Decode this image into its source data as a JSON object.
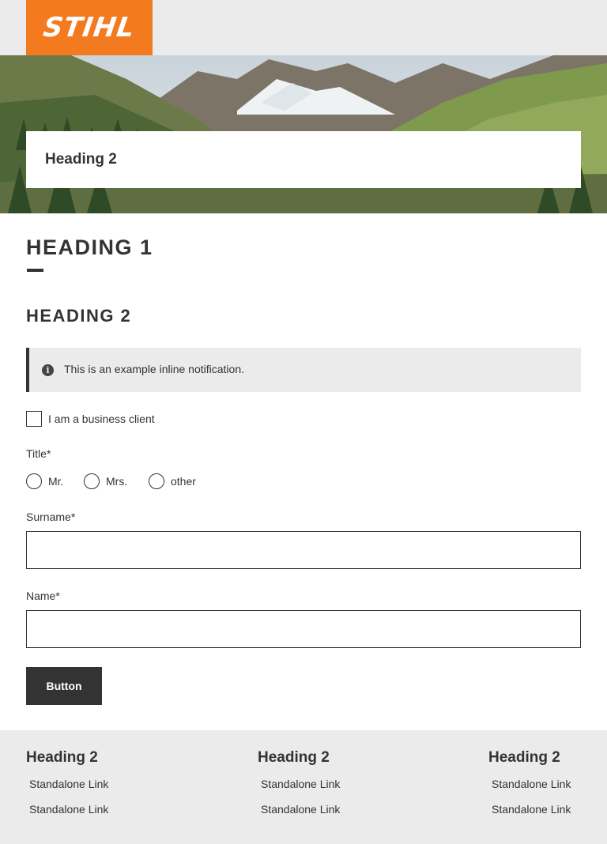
{
  "header": {
    "logo_text": "STIHL",
    "brand_color": "#f37a1f"
  },
  "hero": {
    "image": "alpine-valley-landscape",
    "card_heading": "Heading 2"
  },
  "main": {
    "heading1": "HEADING 1",
    "heading2": "HEADING 2",
    "notification": {
      "icon": "info-icon",
      "text": "This is an example inline notification."
    },
    "checkbox": {
      "label": "I am a business client",
      "checked": false
    },
    "title_field": {
      "label": "Title",
      "required_mark": "*",
      "options": [
        "Mr.",
        "Mrs.",
        "other"
      ],
      "selected": null
    },
    "surname_field": {
      "label": "Surname",
      "required_mark": "*",
      "value": ""
    },
    "name_field": {
      "label": "Name",
      "required_mark": "*",
      "value": ""
    },
    "button_label": "Button"
  },
  "footer": {
    "columns": [
      {
        "heading": "Heading 2",
        "links": [
          "Standalone Link",
          "Standalone Link"
        ]
      },
      {
        "heading": "Heading 2",
        "links": [
          "Standalone Link",
          "Standalone Link"
        ]
      },
      {
        "heading": "Heading 2",
        "links": [
          "Standalone Link",
          "Standalone Link"
        ]
      }
    ]
  },
  "colors": {
    "text": "#333333",
    "surface_grey": "#ebebeb",
    "button_bg": "#333333"
  }
}
